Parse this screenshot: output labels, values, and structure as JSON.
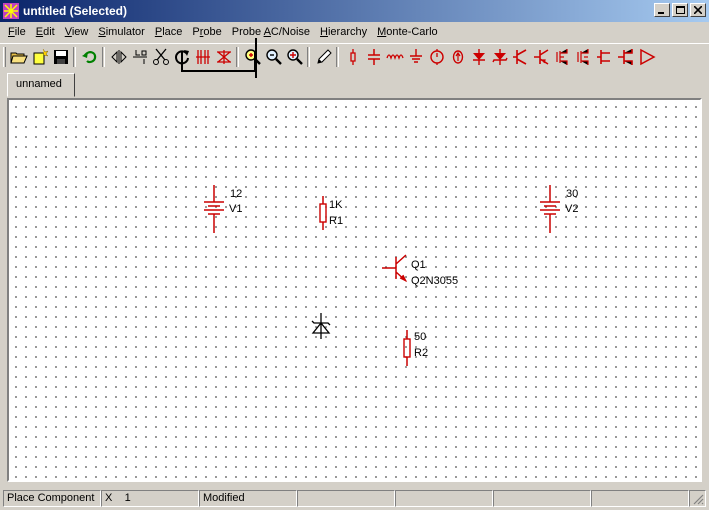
{
  "window": {
    "title": "untitled (Selected)"
  },
  "menu": [
    "File",
    "Edit",
    "View",
    "Simulator",
    "Place",
    "Probe",
    "Probe AC/Noise",
    "Hierarchy",
    "Monte-Carlo"
  ],
  "menu_underline": [
    "F",
    "E",
    "V",
    "S",
    "P",
    "r",
    "A",
    "H",
    "M"
  ],
  "toolbar_icons": [
    "open-folder-icon",
    "new-file-icon",
    "save-icon",
    "undo-icon",
    "flip-horizontal-icon",
    "flip-vertical-icon",
    "cut-icon",
    "rotate-icon",
    "mirror-x-icon",
    "mirror-y-icon",
    "zoom-in-icon",
    "zoom-out-icon",
    "zoom-fit-icon",
    "pencil-icon",
    "resistor-tool-icon",
    "capacitor-tool-icon",
    "inductor-tool-icon",
    "ground-tool-icon",
    "voltage-source-tool-icon",
    "current-source-tool-icon",
    "diode-tool-icon",
    "zener-tool-icon",
    "npn-tool-icon",
    "pnp-tool-icon",
    "nmos-tool-icon",
    "pmos-tool-icon",
    "njfet-tool-icon",
    "pjfet-tool-icon",
    "opamp-tool-icon"
  ],
  "tabs": [
    "unnamed"
  ],
  "components": {
    "v1": {
      "value": "12",
      "name": "V1"
    },
    "r1": {
      "value": "1K",
      "name": "R1"
    },
    "v2": {
      "value": "30",
      "name": "V2"
    },
    "q1": {
      "value": "Q1",
      "name": "Q2N3055"
    },
    "r2": {
      "value": "50",
      "name": "R2"
    }
  },
  "status": {
    "mode": "Place Component",
    "x_label": "X",
    "x_value": "1",
    "state": "Modified"
  },
  "colors": {
    "component": "#cc0000",
    "title_start": "#0a246a",
    "title_end": "#a6caf0"
  }
}
